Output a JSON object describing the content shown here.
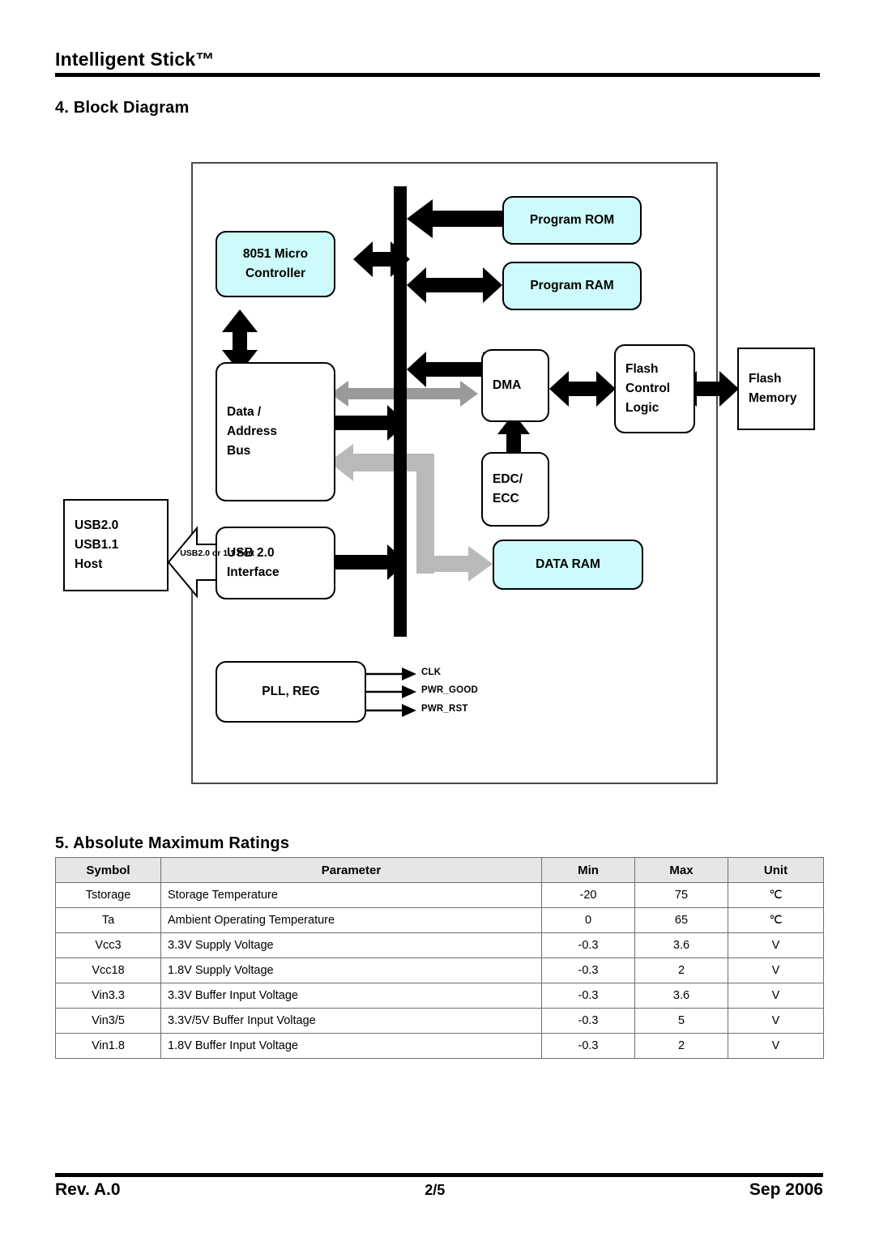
{
  "header": {
    "title": "Intelligent Stick™"
  },
  "sections": {
    "block_diagram": "4. Block Diagram",
    "ratings": "5. Absolute Maximum Ratings"
  },
  "diagram": {
    "blocks": {
      "mcu": {
        "line1": "8051 Micro",
        "line2": "Controller"
      },
      "program_rom": {
        "line1": "Program ROM"
      },
      "program_ram": {
        "line1": "Program RAM"
      },
      "data_address_bus": {
        "line1": "Data /",
        "line2": "Address",
        "line3": "Bus"
      },
      "dma": {
        "line1": "DMA"
      },
      "flash_control_logic": {
        "line1": "Flash",
        "line2": "Control",
        "line3": "Logic"
      },
      "flash_memory": {
        "line1": "Flash",
        "line2": "Memory"
      },
      "edc_ecc": {
        "line1": "EDC/",
        "line2": "ECC"
      },
      "data_ram": {
        "line1": "DATA RAM"
      },
      "usb_host": {
        "line1": "USB2.0",
        "line2": "USB1.1",
        "line3": "Host"
      },
      "usb_interface": {
        "line1": "USB 2.0",
        "line2": "Interface"
      },
      "pll_reg": {
        "line1": "PLL, REG"
      }
    },
    "labels": {
      "usb_port": {
        "line1": "USB2.0 or",
        "line2": "1.1 Port"
      },
      "clk": "CLK",
      "pwr_good": "PWR_GOOD",
      "pwr_rst": "PWR_RST"
    },
    "colors": {
      "highlight": "#cdfbfb",
      "bus_black": "#000000",
      "bus_gray": "#9a9a9a",
      "frame_border": "#4a4a4a"
    }
  },
  "table": {
    "columns": [
      "Symbol",
      "Parameter",
      "Min",
      "Max",
      "Unit"
    ],
    "rows": [
      {
        "symbol": "Tstorage",
        "parameter": "Storage Temperature",
        "min": "-20",
        "max": "75",
        "unit": "℃"
      },
      {
        "symbol": "Ta",
        "parameter": "Ambient Operating Temperature",
        "min": "0",
        "max": "65",
        "unit": "℃"
      },
      {
        "symbol": "Vcc3",
        "parameter": "3.3V Supply Voltage",
        "min": "-0.3",
        "max": "3.6",
        "unit": "V"
      },
      {
        "symbol": "Vcc18",
        "parameter": "1.8V Supply Voltage",
        "min": "-0.3",
        "max": "2",
        "unit": "V"
      },
      {
        "symbol": "Vin3.3",
        "parameter": "3.3V Buffer Input Voltage",
        "min": "-0.3",
        "max": "3.6",
        "unit": "V"
      },
      {
        "symbol": "Vin3/5",
        "parameter": "3.3V/5V Buffer Input Voltage",
        "min": "-0.3",
        "max": "5",
        "unit": "V"
      },
      {
        "symbol": "Vin1.8",
        "parameter": "1.8V Buffer Input Voltage",
        "min": "-0.3",
        "max": "2",
        "unit": "V"
      }
    ]
  },
  "footer": {
    "revision": "Rev. A.0",
    "page": "2/5",
    "date": "Sep 2006"
  }
}
